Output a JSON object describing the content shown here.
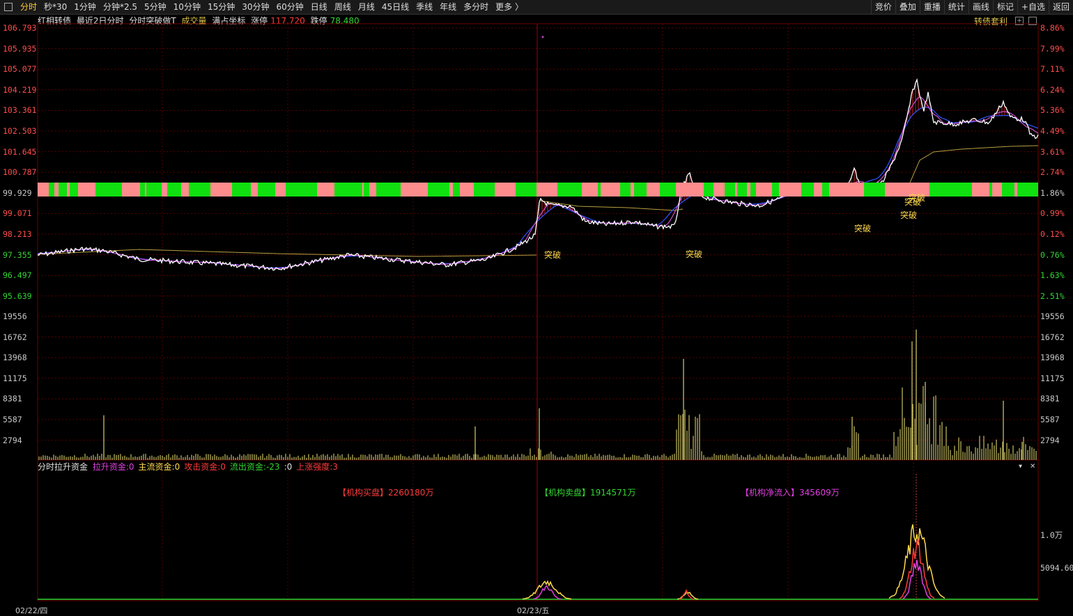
{
  "toolbar": {
    "tabs": [
      "分时",
      "秒*30",
      "1分钟",
      "分钟*2.5",
      "5分钟",
      "10分钟",
      "15分钟",
      "30分钟",
      "60分钟",
      "日线",
      "周线",
      "月线",
      "45日线",
      "季线",
      "年线",
      "多分时",
      "更多 〉"
    ],
    "right_buttons": [
      "竞价",
      "叠加",
      "重播",
      "统计",
      "画线",
      "标记",
      "+自选",
      "返回"
    ]
  },
  "info": {
    "name": "红相转债",
    "mode": "最近2日分时",
    "indicator": "分时突破做T",
    "volume_label": "成交量",
    "coord": "满占坐标",
    "limit_up_label": "涨停",
    "limit_up": "117.720",
    "limit_down_label": "跌停",
    "limit_down": "78.480"
  },
  "brand": "转债套利",
  "price_axis": {
    "left": [
      "106.793",
      "105.935",
      "105.077",
      "104.219",
      "103.361",
      "102.503",
      "101.645",
      "100.787",
      "99.929",
      "99.071",
      "98.213",
      "97.355",
      "96.497",
      "95.639"
    ],
    "right": [
      "8.86%",
      "7.99%",
      "7.11%",
      "6.24%",
      "5.36%",
      "4.49%",
      "3.61%",
      "2.74%",
      "1.86%",
      "0.99%",
      "0.12%",
      "0.76%",
      "1.63%",
      "2.51%"
    ]
  },
  "volume_axis": [
    "19556",
    "16762",
    "13968",
    "11175",
    "8381",
    "5587",
    "2794"
  ],
  "indicator_panel": {
    "title": "分时拉升资金",
    "items": [
      {
        "label": "拉升资金:",
        "value": "0",
        "color": "#e040e0"
      },
      {
        "label": "主流资金:",
        "value": "0",
        "color": "#ffd94d"
      },
      {
        "label": "攻击资金:",
        "value": "0",
        "color": "#ff3b3b"
      },
      {
        "label": "流出资金:",
        "value": "-23",
        "color": "#33d633"
      },
      {
        "label": ":",
        "value": "0",
        "color": "#e0e0e0"
      },
      {
        "label": "上涨强度:",
        "value": "3",
        "color": "#ff3b3b"
      }
    ],
    "buy_label": "【机构买盘】2260180万",
    "sell_label": "【机构卖盘】1914571万",
    "net_label": "【机构净流入】345609万",
    "axis": [
      "1.0万",
      "5094.60"
    ]
  },
  "breakout_label": "突破",
  "dates": [
    "02/22/四",
    "02/23/五"
  ],
  "colors": {
    "price_line": "#ffffff",
    "avg_line": "#3355ff",
    "ma_line": "#d050d0",
    "gold_line": "#b8a040",
    "volume": "#c8c060",
    "grid": "#5a0000",
    "up": "#ff6b6b",
    "down": "#33ff33",
    "band_red": "#ff8c8c",
    "band_green": "#10e010"
  }
}
